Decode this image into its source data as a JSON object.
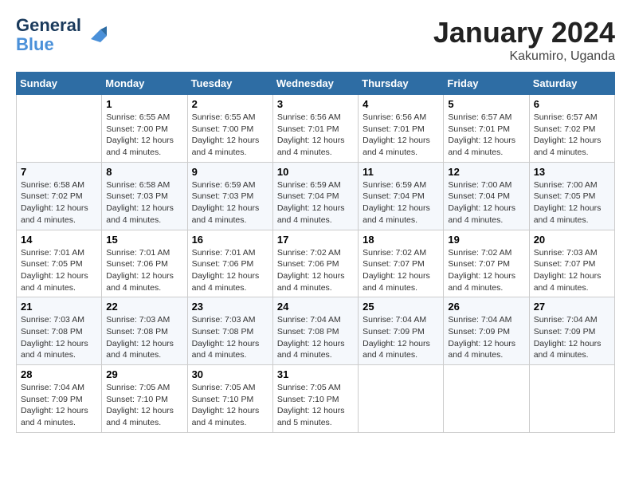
{
  "header": {
    "logo_line1": "General",
    "logo_line2": "Blue",
    "month": "January 2024",
    "location": "Kakumiro, Uganda"
  },
  "days_of_week": [
    "Sunday",
    "Monday",
    "Tuesday",
    "Wednesday",
    "Thursday",
    "Friday",
    "Saturday"
  ],
  "weeks": [
    [
      {
        "day": "",
        "sunrise": "",
        "sunset": "",
        "daylight": ""
      },
      {
        "day": "1",
        "sunrise": "Sunrise: 6:55 AM",
        "sunset": "Sunset: 7:00 PM",
        "daylight": "Daylight: 12 hours and 4 minutes."
      },
      {
        "day": "2",
        "sunrise": "Sunrise: 6:55 AM",
        "sunset": "Sunset: 7:00 PM",
        "daylight": "Daylight: 12 hours and 4 minutes."
      },
      {
        "day": "3",
        "sunrise": "Sunrise: 6:56 AM",
        "sunset": "Sunset: 7:01 PM",
        "daylight": "Daylight: 12 hours and 4 minutes."
      },
      {
        "day": "4",
        "sunrise": "Sunrise: 6:56 AM",
        "sunset": "Sunset: 7:01 PM",
        "daylight": "Daylight: 12 hours and 4 minutes."
      },
      {
        "day": "5",
        "sunrise": "Sunrise: 6:57 AM",
        "sunset": "Sunset: 7:01 PM",
        "daylight": "Daylight: 12 hours and 4 minutes."
      },
      {
        "day": "6",
        "sunrise": "Sunrise: 6:57 AM",
        "sunset": "Sunset: 7:02 PM",
        "daylight": "Daylight: 12 hours and 4 minutes."
      }
    ],
    [
      {
        "day": "7",
        "sunrise": "Sunrise: 6:58 AM",
        "sunset": "Sunset: 7:02 PM",
        "daylight": "Daylight: 12 hours and 4 minutes."
      },
      {
        "day": "8",
        "sunrise": "Sunrise: 6:58 AM",
        "sunset": "Sunset: 7:03 PM",
        "daylight": "Daylight: 12 hours and 4 minutes."
      },
      {
        "day": "9",
        "sunrise": "Sunrise: 6:59 AM",
        "sunset": "Sunset: 7:03 PM",
        "daylight": "Daylight: 12 hours and 4 minutes."
      },
      {
        "day": "10",
        "sunrise": "Sunrise: 6:59 AM",
        "sunset": "Sunset: 7:04 PM",
        "daylight": "Daylight: 12 hours and 4 minutes."
      },
      {
        "day": "11",
        "sunrise": "Sunrise: 6:59 AM",
        "sunset": "Sunset: 7:04 PM",
        "daylight": "Daylight: 12 hours and 4 minutes."
      },
      {
        "day": "12",
        "sunrise": "Sunrise: 7:00 AM",
        "sunset": "Sunset: 7:04 PM",
        "daylight": "Daylight: 12 hours and 4 minutes."
      },
      {
        "day": "13",
        "sunrise": "Sunrise: 7:00 AM",
        "sunset": "Sunset: 7:05 PM",
        "daylight": "Daylight: 12 hours and 4 minutes."
      }
    ],
    [
      {
        "day": "14",
        "sunrise": "Sunrise: 7:01 AM",
        "sunset": "Sunset: 7:05 PM",
        "daylight": "Daylight: 12 hours and 4 minutes."
      },
      {
        "day": "15",
        "sunrise": "Sunrise: 7:01 AM",
        "sunset": "Sunset: 7:06 PM",
        "daylight": "Daylight: 12 hours and 4 minutes."
      },
      {
        "day": "16",
        "sunrise": "Sunrise: 7:01 AM",
        "sunset": "Sunset: 7:06 PM",
        "daylight": "Daylight: 12 hours and 4 minutes."
      },
      {
        "day": "17",
        "sunrise": "Sunrise: 7:02 AM",
        "sunset": "Sunset: 7:06 PM",
        "daylight": "Daylight: 12 hours and 4 minutes."
      },
      {
        "day": "18",
        "sunrise": "Sunrise: 7:02 AM",
        "sunset": "Sunset: 7:07 PM",
        "daylight": "Daylight: 12 hours and 4 minutes."
      },
      {
        "day": "19",
        "sunrise": "Sunrise: 7:02 AM",
        "sunset": "Sunset: 7:07 PM",
        "daylight": "Daylight: 12 hours and 4 minutes."
      },
      {
        "day": "20",
        "sunrise": "Sunrise: 7:03 AM",
        "sunset": "Sunset: 7:07 PM",
        "daylight": "Daylight: 12 hours and 4 minutes."
      }
    ],
    [
      {
        "day": "21",
        "sunrise": "Sunrise: 7:03 AM",
        "sunset": "Sunset: 7:08 PM",
        "daylight": "Daylight: 12 hours and 4 minutes."
      },
      {
        "day": "22",
        "sunrise": "Sunrise: 7:03 AM",
        "sunset": "Sunset: 7:08 PM",
        "daylight": "Daylight: 12 hours and 4 minutes."
      },
      {
        "day": "23",
        "sunrise": "Sunrise: 7:03 AM",
        "sunset": "Sunset: 7:08 PM",
        "daylight": "Daylight: 12 hours and 4 minutes."
      },
      {
        "day": "24",
        "sunrise": "Sunrise: 7:04 AM",
        "sunset": "Sunset: 7:08 PM",
        "daylight": "Daylight: 12 hours and 4 minutes."
      },
      {
        "day": "25",
        "sunrise": "Sunrise: 7:04 AM",
        "sunset": "Sunset: 7:09 PM",
        "daylight": "Daylight: 12 hours and 4 minutes."
      },
      {
        "day": "26",
        "sunrise": "Sunrise: 7:04 AM",
        "sunset": "Sunset: 7:09 PM",
        "daylight": "Daylight: 12 hours and 4 minutes."
      },
      {
        "day": "27",
        "sunrise": "Sunrise: 7:04 AM",
        "sunset": "Sunset: 7:09 PM",
        "daylight": "Daylight: 12 hours and 4 minutes."
      }
    ],
    [
      {
        "day": "28",
        "sunrise": "Sunrise: 7:04 AM",
        "sunset": "Sunset: 7:09 PM",
        "daylight": "Daylight: 12 hours and 4 minutes."
      },
      {
        "day": "29",
        "sunrise": "Sunrise: 7:05 AM",
        "sunset": "Sunset: 7:10 PM",
        "daylight": "Daylight: 12 hours and 4 minutes."
      },
      {
        "day": "30",
        "sunrise": "Sunrise: 7:05 AM",
        "sunset": "Sunset: 7:10 PM",
        "daylight": "Daylight: 12 hours and 4 minutes."
      },
      {
        "day": "31",
        "sunrise": "Sunrise: 7:05 AM",
        "sunset": "Sunset: 7:10 PM",
        "daylight": "Daylight: 12 hours and 5 minutes."
      },
      {
        "day": "",
        "sunrise": "",
        "sunset": "",
        "daylight": ""
      },
      {
        "day": "",
        "sunrise": "",
        "sunset": "",
        "daylight": ""
      },
      {
        "day": "",
        "sunrise": "",
        "sunset": "",
        "daylight": ""
      }
    ]
  ]
}
